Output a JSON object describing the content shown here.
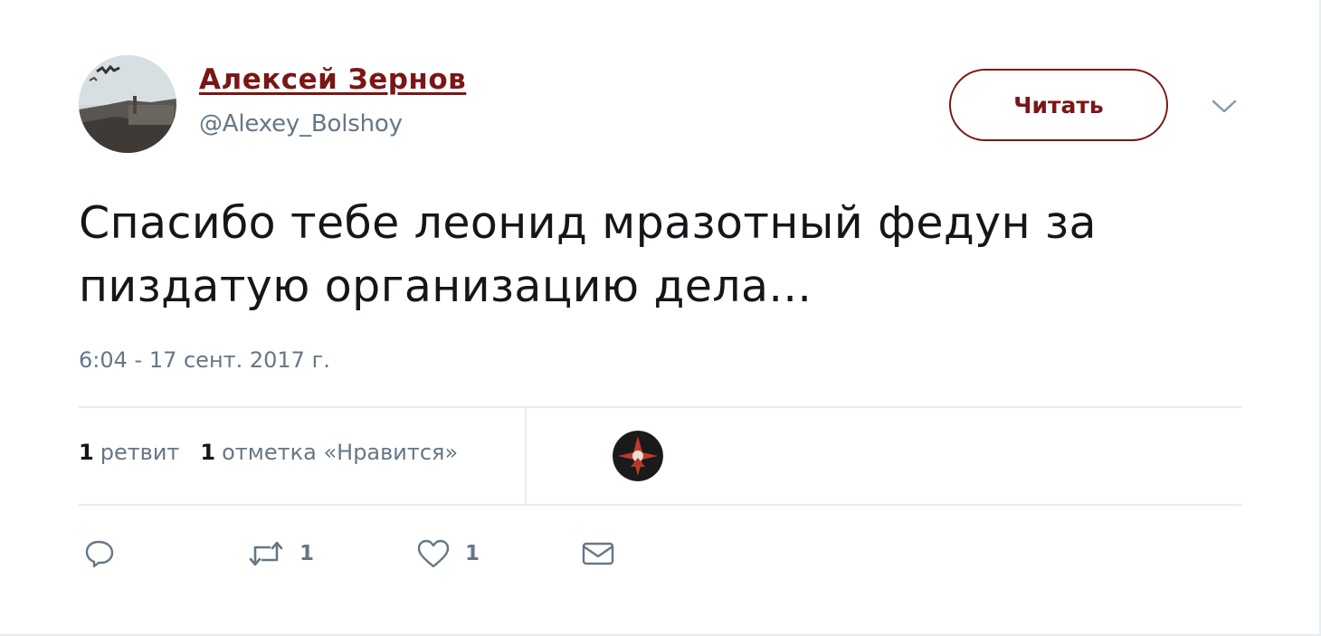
{
  "author": {
    "name": "Алексей Зернов",
    "handle": "@Alexey_Bolshoy",
    "avatar_icon": "avatar-photo"
  },
  "follow_button": {
    "label": "Читать"
  },
  "menu_caret_icon": "chevron-down-icon",
  "tweet": {
    "text": "Спасибо тебе леонид мразотный федун за пиздатую организацию дела...",
    "timestamp": "6:04 - 17 сент. 2017 г."
  },
  "stats": {
    "retweets_count": "1",
    "retweets_label": "ретвит",
    "likes_count": "1",
    "likes_label": "отметка «Нравится»"
  },
  "actions": {
    "reply_icon": "reply-icon",
    "retweet_icon": "retweet-icon",
    "retweet_count": "1",
    "like_icon": "heart-icon",
    "like_count": "1",
    "message_icon": "envelope-icon"
  },
  "colors": {
    "accent": "#7b1616",
    "text": "#14171a",
    "muted": "#657786",
    "divider": "#e6ecf0"
  }
}
